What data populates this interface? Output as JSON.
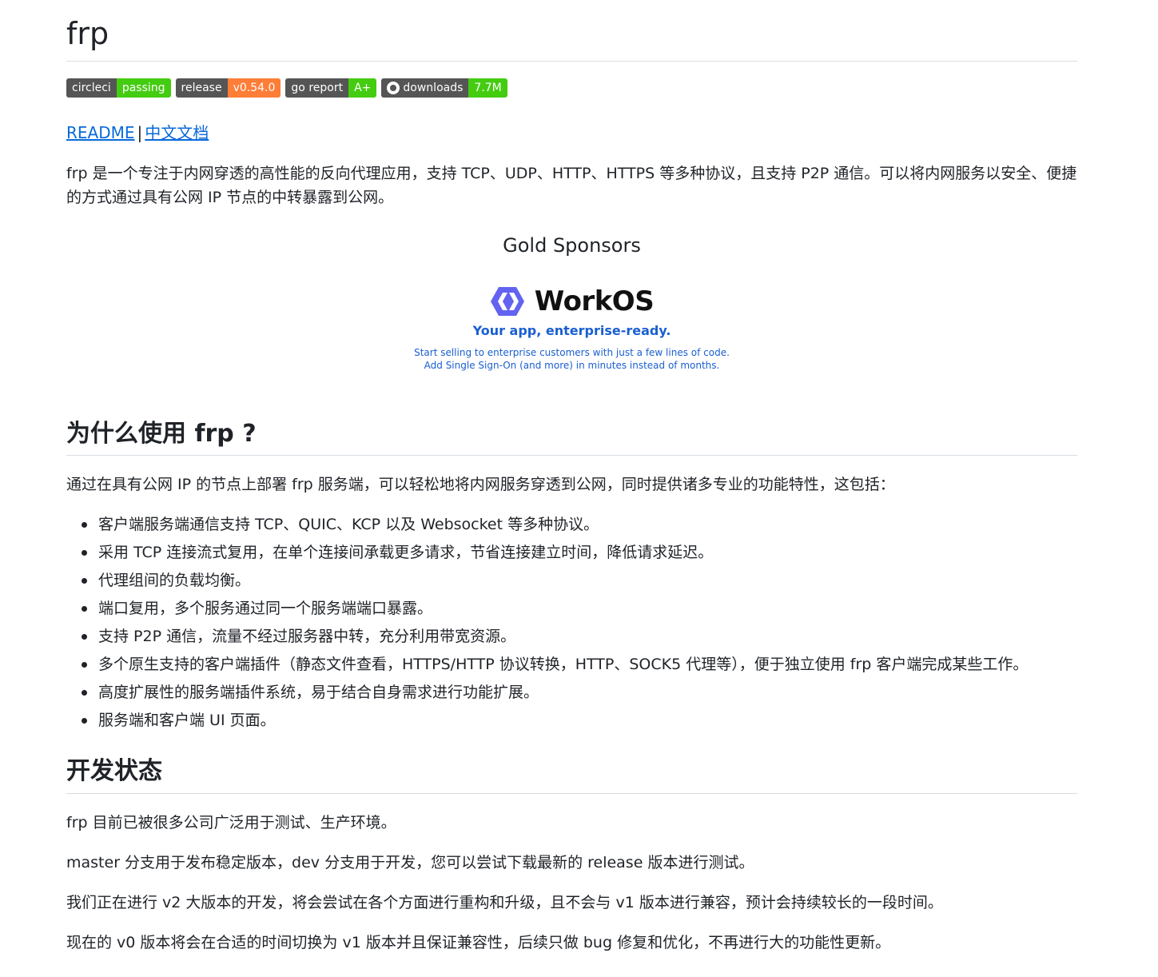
{
  "title": "frp",
  "badges": [
    {
      "label": "circleci",
      "value": "passing",
      "color": "#4c1"
    },
    {
      "label": "release",
      "value": "v0.54.0",
      "color": "#fe7d37"
    },
    {
      "label": "go report",
      "value": "A+",
      "color": "#4c1"
    },
    {
      "label": "downloads",
      "value": "7.7M",
      "color": "#4c1",
      "icon": "github-icon"
    }
  ],
  "links": {
    "readme": "README",
    "separator": "|",
    "chinese_docs": "中文文档"
  },
  "intro": "frp 是一个专注于内网穿透的高性能的反向代理应用，支持 TCP、UDP、HTTP、HTTPS 等多种协议，且支持 P2P 通信。可以将内网服务以安全、便捷的方式通过具有公网 IP 节点的中转暴露到公网。",
  "sponsors": {
    "heading": "Gold Sponsors",
    "workos": {
      "name": "WorkOS",
      "tagline": "Your app, enterprise-ready.",
      "line1": "Start selling to enterprise customers with just a few lines of code.",
      "line2": "Add Single Sign-On (and more) in minutes instead of months."
    }
  },
  "why": {
    "heading": "为什么使用 frp ?",
    "intro": "通过在具有公网 IP 的节点上部署 frp 服务端，可以轻松地将内网服务穿透到公网，同时提供诸多专业的功能特性，这包括：",
    "features": [
      "客户端服务端通信支持 TCP、QUIC、KCP 以及 Websocket 等多种协议。",
      "采用 TCP 连接流式复用，在单个连接间承载更多请求，节省连接建立时间，降低请求延迟。",
      "代理组间的负载均衡。",
      "端口复用，多个服务通过同一个服务端端口暴露。",
      "支持 P2P 通信，流量不经过服务器中转，充分利用带宽资源。",
      "多个原生支持的客户端插件（静态文件查看，HTTPS/HTTP 协议转换，HTTP、SOCK5 代理等），便于独立使用 frp 客户端完成某些工作。",
      "高度扩展性的服务端插件系统，易于结合自身需求进行功能扩展。",
      "服务端和客户端 UI 页面。"
    ]
  },
  "status": {
    "heading": "开发状态",
    "paragraphs": [
      "frp 目前已被很多公司广泛用于测试、生产环境。",
      "master 分支用于发布稳定版本，dev 分支用于开发，您可以尝试下载最新的 release 版本进行测试。",
      "我们正在进行 v2 大版本的开发，将会尝试在各个方面进行重构和升级，且不会与 v1 版本进行兼容，预计会持续较长的一段时间。",
      "现在的 v0 版本将会在合适的时间切换为 v1 版本并且保证兼容性，后续只做 bug 修复和优化，不再进行大的功能性更新。"
    ]
  }
}
